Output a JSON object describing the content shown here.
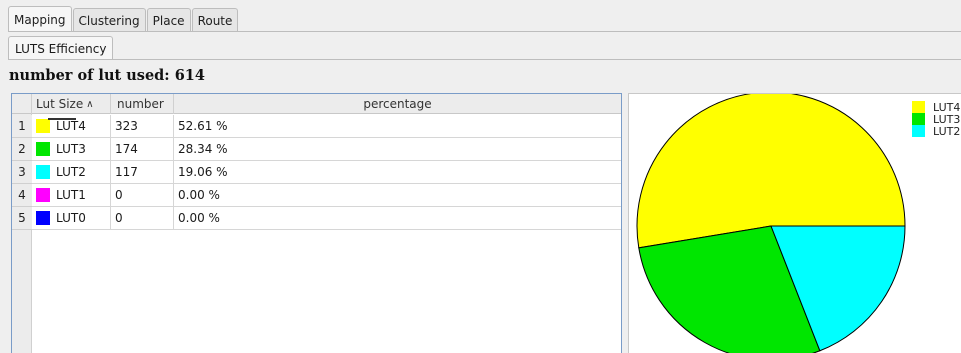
{
  "tabs": [
    "Mapping",
    "Clustering",
    "Place",
    "Route"
  ],
  "subtab": "LUTS Efficiency",
  "summary": "number of lut used: 614",
  "table": {
    "headers": [
      "Lut Size",
      "number",
      "percentage"
    ],
    "rows": [
      {
        "num": "1",
        "name": "LUT4",
        "color": "#ffff00",
        "number": "323",
        "pct": "52.61 %"
      },
      {
        "num": "2",
        "name": "LUT3",
        "color": "#00e600",
        "number": "174",
        "pct": "28.34 %"
      },
      {
        "num": "3",
        "name": "LUT2",
        "color": "#00ffff",
        "number": "117",
        "pct": "19.06 %"
      },
      {
        "num": "4",
        "name": "LUT1",
        "color": "#ff00ff",
        "number": "0",
        "pct": "0.00 %"
      },
      {
        "num": "5",
        "name": "LUT0",
        "color": "#0000ff",
        "number": "0",
        "pct": "0.00 %"
      }
    ]
  },
  "chart_data": {
    "type": "pie",
    "labels": [
      "LUT4",
      "LUT3",
      "LUT2"
    ],
    "values": [
      323,
      174,
      117
    ],
    "colors": [
      "#ffff00",
      "#00e600",
      "#00ffff"
    ],
    "legend": "top-right"
  }
}
